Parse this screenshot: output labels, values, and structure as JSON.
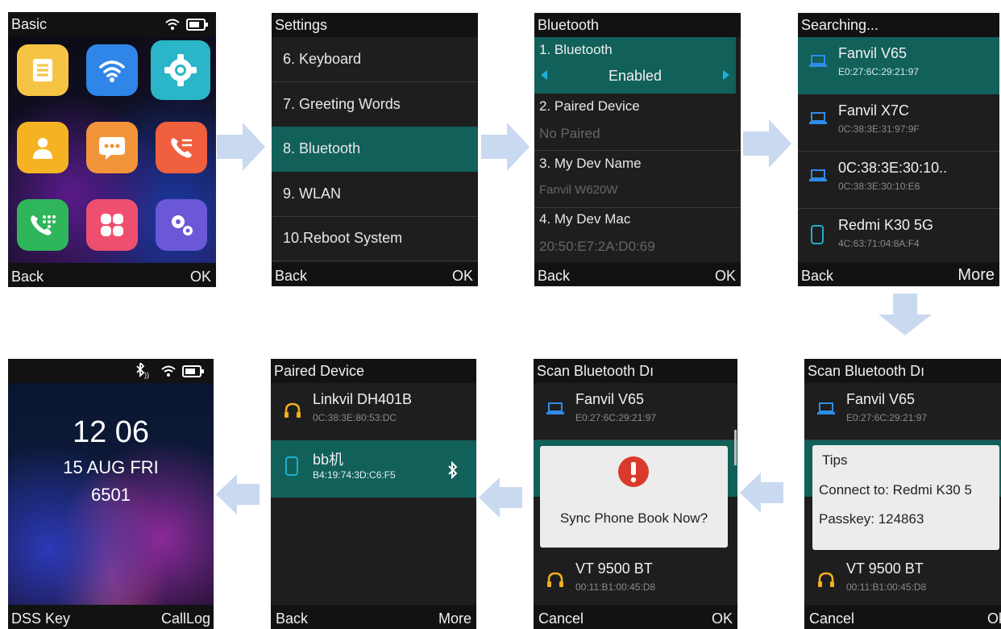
{
  "screen1": {
    "title": "Basic",
    "softkeys": {
      "left": "Back",
      "right": "OK"
    },
    "icons": [
      "contacts-book-icon",
      "wifi-icon",
      "settings-gear-icon",
      "person-icon",
      "message-icon",
      "call-forward-icon",
      "dialpad-icon",
      "apps-icon",
      "advanced-settings-icon"
    ],
    "colors": {
      "tile1": "#f6c445",
      "tile2": "#2f86e8",
      "tile3": "#2bb5c8",
      "tile4": "#f5b323",
      "tile5": "#f2953a",
      "tile6": "#f0603e",
      "tile7": "#2fb65a",
      "tile8": "#ef4f6e",
      "tile9": "#6a58d6"
    }
  },
  "screen2": {
    "title": "Settings",
    "items": [
      "6. Keyboard",
      "7. Greeting Words",
      "8. Bluetooth",
      "9. WLAN",
      "10.Reboot System"
    ],
    "selected": "8. Bluetooth",
    "softkeys": {
      "left": "Back",
      "right": "OK"
    }
  },
  "screen3": {
    "title": "Bluetooth",
    "items": [
      {
        "label": "1. Bluetooth",
        "value": "Enabled"
      },
      {
        "label": "2. Paired Device",
        "value": "No Paired"
      },
      {
        "label": "3. My Dev Name",
        "value": "Fanvil W620W"
      },
      {
        "label": "4. My Dev Mac",
        "value": "20:50:E7:2A:D0:69"
      }
    ],
    "softkeys": {
      "left": "Back",
      "right": "OK"
    }
  },
  "screen4": {
    "title": "Searching...",
    "devices": [
      {
        "name": "Fanvil V65",
        "mac": "E0:27:6C:29:21:97",
        "icon": "laptop-icon"
      },
      {
        "name": "Fanvil X7C",
        "mac": "0C:38:3E:31:97:9F",
        "icon": "laptop-icon"
      },
      {
        "name": "0C:38:3E:30:10..",
        "mac": "0C:38:3E:30:10:E6",
        "icon": "laptop-icon"
      },
      {
        "name": "Redmi K30 5G",
        "mac": "4C:63:71:04:8A:F4",
        "icon": "phone-icon"
      }
    ],
    "softkeys": {
      "left": "Back",
      "right": "More"
    }
  },
  "screen5": {
    "title": "Scan Bluetooth Dı",
    "devices": [
      {
        "name": "Fanvil V65",
        "mac": "E0:27:6C:29:21:97",
        "icon": "laptop-icon"
      },
      {
        "name": "VT 9500 BT",
        "mac": "00:11:B1:00:45:D8",
        "icon": "headphones-icon"
      }
    ],
    "dialog": {
      "title": "Tips",
      "line1": "Connect to: Redmi K30 5",
      "line2": "Passkey: 124863"
    },
    "softkeys": {
      "left": "Cancel",
      "right": "Ok"
    }
  },
  "screen6": {
    "title": "Scan Bluetooth Dı",
    "devices": [
      {
        "name": "Fanvil V65",
        "mac": "E0:27:6C:29:21:97",
        "icon": "laptop-icon"
      },
      {
        "name": "VT 9500 BT",
        "mac": "00:11:B1:00:45:D8",
        "icon": "headphones-icon"
      }
    ],
    "dialog": {
      "message": "Sync Phone Book Now?",
      "icon": "alert-icon"
    },
    "softkeys": {
      "left": "Cancel",
      "right": "OK"
    }
  },
  "screen7": {
    "title": "Paired Device",
    "devices": [
      {
        "name": "Linkvil DH401B",
        "mac": "0C:38:3E:80:53:DC",
        "icon": "headphones-icon"
      },
      {
        "name": "bb机",
        "mac": "B4:19:74:3D:C6:F5",
        "icon": "phone-icon",
        "status_icon": "bluetooth-icon"
      }
    ],
    "softkeys": {
      "left": "Back",
      "right": "More"
    }
  },
  "screen8": {
    "time": "12 06",
    "date": "15 AUG FRI",
    "extension": "6501",
    "status_icons": [
      "bluetooth-connected-icon",
      "wifi-icon",
      "battery-icon"
    ],
    "softkeys": {
      "left": "DSS Key",
      "right": "CallLog"
    }
  },
  "colors": {
    "highlight": "#11605a",
    "arrow": "#c9d9ef",
    "device_icon_blue": "#2f8de8",
    "headphone_yellow": "#f2b01e",
    "alert_red": "#d93a2b"
  }
}
